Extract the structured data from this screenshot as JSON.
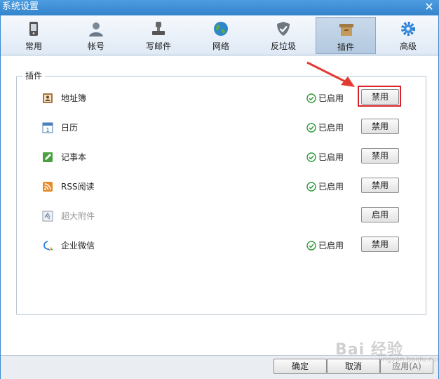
{
  "window": {
    "title": "系统设置"
  },
  "toolbar": {
    "tabs": [
      {
        "label": "常用",
        "icon": "phone-icon"
      },
      {
        "label": "帐号",
        "icon": "user-icon"
      },
      {
        "label": "写邮件",
        "icon": "stamp-icon"
      },
      {
        "label": "网络",
        "icon": "globe-icon"
      },
      {
        "label": "反垃圾",
        "icon": "shield-icon"
      },
      {
        "label": "插件",
        "icon": "box-icon",
        "active": true
      },
      {
        "label": "高级",
        "icon": "gear-icon"
      }
    ]
  },
  "plugins": {
    "group_title": "插件",
    "items": [
      {
        "name": "地址簿",
        "icon": "address-book-icon",
        "status": "已启用",
        "action": "禁用",
        "enabled": true
      },
      {
        "name": "日历",
        "icon": "calendar-icon",
        "status": "已启用",
        "action": "禁用",
        "enabled": true
      },
      {
        "name": "记事本",
        "icon": "notepad-icon",
        "status": "已启用",
        "action": "禁用",
        "enabled": true
      },
      {
        "name": "RSS阅读",
        "icon": "rss-icon",
        "status": "已启用",
        "action": "禁用",
        "enabled": true
      },
      {
        "name": "超大附件",
        "icon": "attachment-icon",
        "status": "",
        "action": "启用",
        "enabled": false
      },
      {
        "name": "企业微信",
        "icon": "wechat-work-icon",
        "status": "已启用",
        "action": "禁用",
        "enabled": true
      }
    ]
  },
  "footer": {
    "ok_label": "确定",
    "cancel_label": "取消",
    "apply_label": "应用(A)"
  },
  "watermark": {
    "text": "Bai 经验",
    "sub": "jingyan.baidu.com"
  },
  "colors": {
    "accent": "#3a88cf",
    "highlight": "#d8232a",
    "status_ok": "#2e9a3a"
  }
}
